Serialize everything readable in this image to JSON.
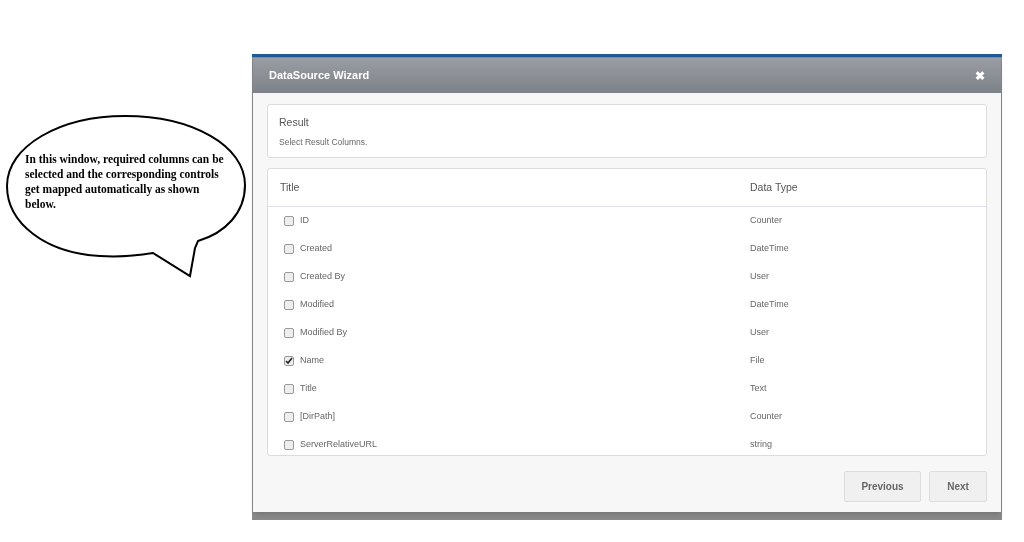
{
  "callout": {
    "text": "In this window, required columns can be selected and the corresponding controls get mapped automatically as shown below."
  },
  "dialog": {
    "title": "DataSource Wizard",
    "close": "✖",
    "section": {
      "title": "Result",
      "subtitle": "Select Result Columns."
    },
    "table": {
      "columns": [
        "Title",
        "Data Type"
      ],
      "rows": [
        {
          "title": "ID",
          "type": "Counter",
          "checked": false
        },
        {
          "title": "Created",
          "type": "DateTime",
          "checked": false
        },
        {
          "title": "Created By",
          "type": "User",
          "checked": false
        },
        {
          "title": "Modified",
          "type": "DateTime",
          "checked": false
        },
        {
          "title": "Modified By",
          "type": "User",
          "checked": false
        },
        {
          "title": "Name",
          "type": "File",
          "checked": true
        },
        {
          "title": "Title",
          "type": "Text",
          "checked": false
        },
        {
          "title": "[DirPath]",
          "type": "Counter",
          "checked": false
        },
        {
          "title": "ServerRelativeURL",
          "type": "string",
          "checked": false
        }
      ]
    },
    "buttons": [
      "Previous",
      "Next"
    ]
  }
}
